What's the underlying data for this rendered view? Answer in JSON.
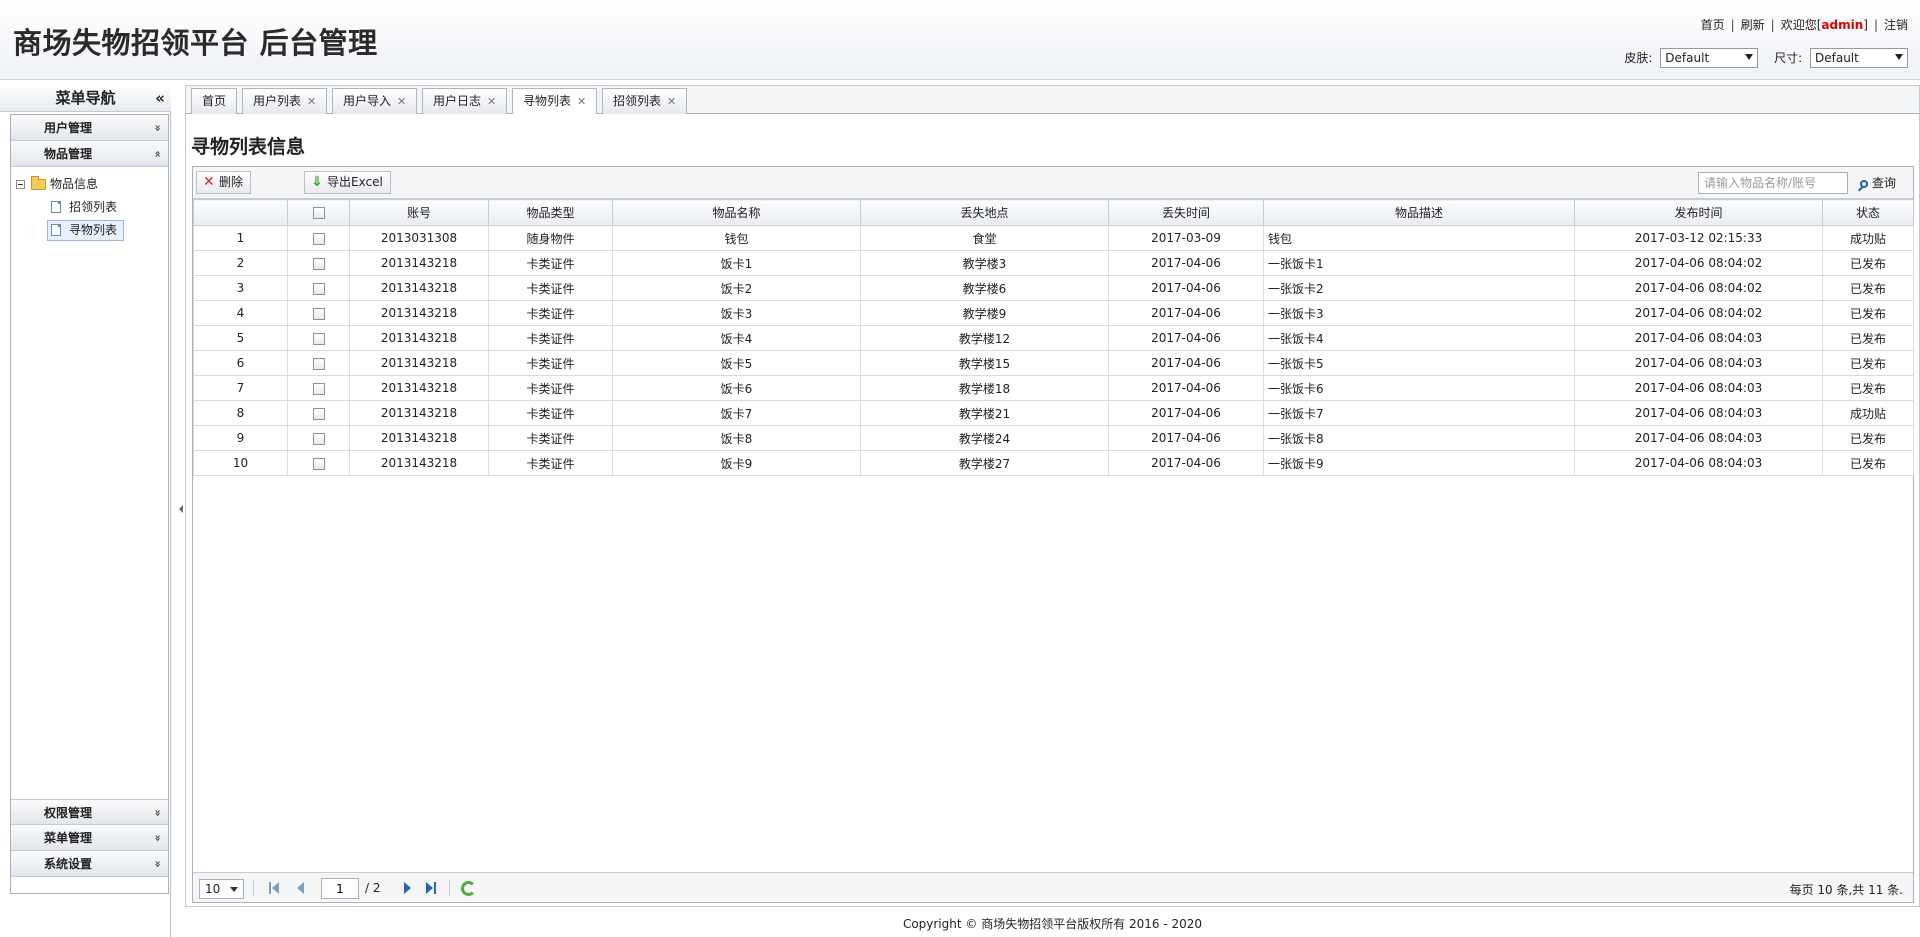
{
  "header": {
    "title": "商场失物招领平台 后台管理",
    "links": {
      "home": "首页",
      "refresh": "刷新",
      "welcome": "欢迎您[",
      "user": "admin",
      "welcome_end": "]",
      "logout": "注销"
    },
    "skin_label": "皮肤:",
    "skin_value": "Default",
    "size_label": "尺寸:",
    "size_value": "Default"
  },
  "menu": {
    "title": "菜单导航",
    "collapse": "«",
    "groups": [
      {
        "label": "用户管理",
        "chev": "»"
      },
      {
        "label": "物品管理",
        "chev": "«"
      },
      {
        "label": "权限管理",
        "chev": "»"
      },
      {
        "label": "菜单管理",
        "chev": "»"
      },
      {
        "label": "系统设置",
        "chev": "»"
      }
    ],
    "tree": {
      "folder": "物品信息",
      "items": [
        "招领列表",
        "寻物列表"
      ]
    }
  },
  "tabs": [
    {
      "label": "首页",
      "closable": false
    },
    {
      "label": "用户列表",
      "closable": true
    },
    {
      "label": "用户导入",
      "closable": true
    },
    {
      "label": "用户日志",
      "closable": true
    },
    {
      "label": "寻物列表",
      "closable": true,
      "active": true
    },
    {
      "label": "招领列表",
      "closable": true
    }
  ],
  "page_title": "寻物列表信息",
  "toolbar": {
    "delete_label": "删除",
    "export_label": "导出Excel",
    "search_placeholder": "请输入物品名称/账号",
    "search_label": "查询"
  },
  "grid": {
    "columns": [
      "",
      "",
      "账号",
      "物品类型",
      "物品名称",
      "丢失地点",
      "丢失时间",
      "物品描述",
      "发布时间",
      "状态"
    ],
    "rows": [
      [
        "1",
        "2013031308",
        "随身物件",
        "钱包",
        "食堂",
        "2017-03-09",
        "钱包",
        "2017-03-12 02:15:33",
        "成功贴"
      ],
      [
        "2",
        "2013143218",
        "卡类证件",
        "饭卡1",
        "教学楼3",
        "2017-04-06",
        "一张饭卡1",
        "2017-04-06 08:04:02",
        "已发布"
      ],
      [
        "3",
        "2013143218",
        "卡类证件",
        "饭卡2",
        "教学楼6",
        "2017-04-06",
        "一张饭卡2",
        "2017-04-06 08:04:02",
        "已发布"
      ],
      [
        "4",
        "2013143218",
        "卡类证件",
        "饭卡3",
        "教学楼9",
        "2017-04-06",
        "一张饭卡3",
        "2017-04-06 08:04:02",
        "已发布"
      ],
      [
        "5",
        "2013143218",
        "卡类证件",
        "饭卡4",
        "教学楼12",
        "2017-04-06",
        "一张饭卡4",
        "2017-04-06 08:04:03",
        "已发布"
      ],
      [
        "6",
        "2013143218",
        "卡类证件",
        "饭卡5",
        "教学楼15",
        "2017-04-06",
        "一张饭卡5",
        "2017-04-06 08:04:03",
        "已发布"
      ],
      [
        "7",
        "2013143218",
        "卡类证件",
        "饭卡6",
        "教学楼18",
        "2017-04-06",
        "一张饭卡6",
        "2017-04-06 08:04:03",
        "已发布"
      ],
      [
        "8",
        "2013143218",
        "卡类证件",
        "饭卡7",
        "教学楼21",
        "2017-04-06",
        "一张饭卡7",
        "2017-04-06 08:04:03",
        "成功贴"
      ],
      [
        "9",
        "2013143218",
        "卡类证件",
        "饭卡8",
        "教学楼24",
        "2017-04-06",
        "一张饭卡8",
        "2017-04-06 08:04:03",
        "已发布"
      ],
      [
        "10",
        "2013143218",
        "卡类证件",
        "饭卡9",
        "教学楼27",
        "2017-04-06",
        "一张饭卡9",
        "2017-04-06 08:04:03",
        "已发布"
      ]
    ]
  },
  "pager": {
    "page_size": "10",
    "current_page": "1",
    "total_pages": "/ 2",
    "info": "每页 10 条,共 11 条."
  },
  "footer": "Copyright © 商场失物招领平台版权所有  2016 - 2020",
  "colors": {
    "admin": "#e00000",
    "refresh": "#4fae3a",
    "nav": "#2a62b4"
  }
}
